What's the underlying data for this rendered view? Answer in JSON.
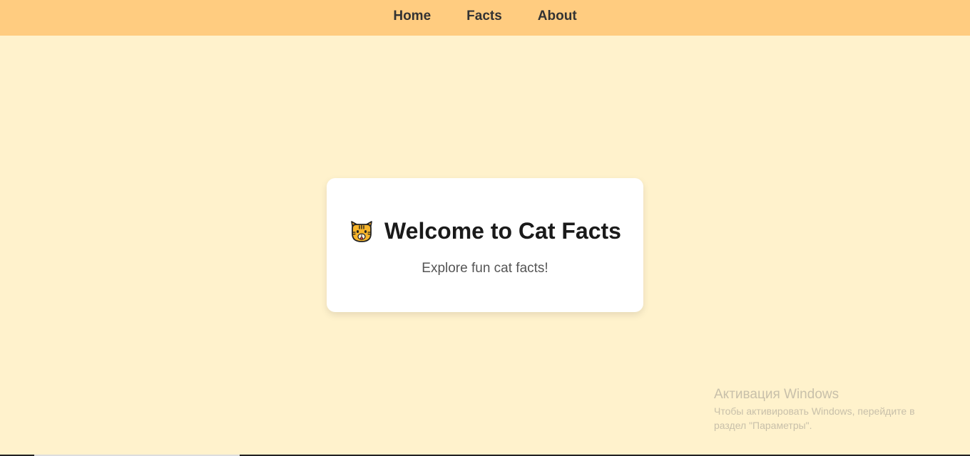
{
  "nav": {
    "items": [
      {
        "label": "Home"
      },
      {
        "label": "Facts"
      },
      {
        "label": "About"
      }
    ]
  },
  "card": {
    "icon": "cat-face-icon",
    "title": "Welcome to Cat Facts",
    "subtitle": "Explore fun cat facts!"
  },
  "watermark": {
    "title": "Активация Windows",
    "line1": "Чтобы активировать Windows, перейдите в",
    "line2": "раздел \"Параметры\"."
  },
  "colors": {
    "background": "#fff2cc",
    "navbar": "#ffcc80",
    "card": "#ffffff",
    "title_text": "#1a1a1a",
    "nav_text": "#333333"
  }
}
